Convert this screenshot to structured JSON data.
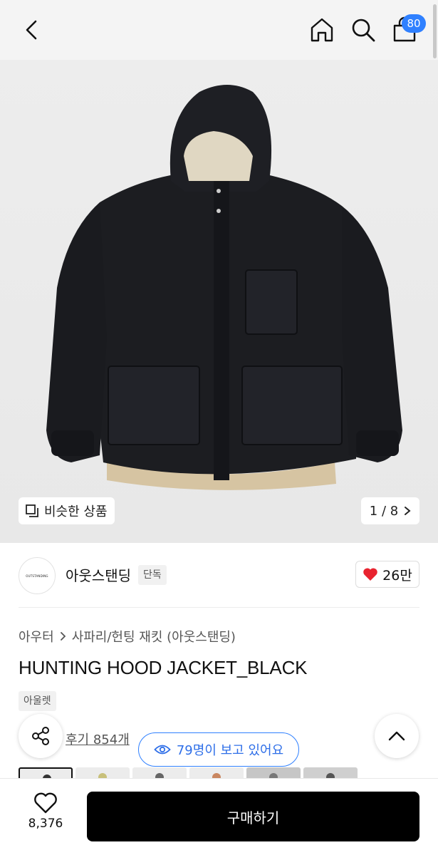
{
  "header": {
    "cart_count": "80",
    "icons": [
      "back-icon",
      "home-icon",
      "search-icon",
      "cart-icon"
    ]
  },
  "gallery": {
    "similar_label": "비슷한 상품",
    "pager": "1 / 8"
  },
  "brand": {
    "logo_text": "OUTSTANDING",
    "name": "아웃스탠딩",
    "tag": "단독",
    "likes": "26만"
  },
  "product": {
    "breadcrumb_parent": "아우터",
    "breadcrumb_child": "사파리/헌팅 재킷 (아웃스탠딩)",
    "title": "HUNTING HOOD JACKET_BLACK",
    "tag": "아울렛",
    "reviews": "후기 854개",
    "viewing": "79명이 보고 있어요"
  },
  "bottom": {
    "wish_count": "8,376",
    "buy_label": "구매하기"
  },
  "colors": {
    "accent": "#2f80ff",
    "heart": "#e8232f",
    "buy_button": "#000000"
  }
}
